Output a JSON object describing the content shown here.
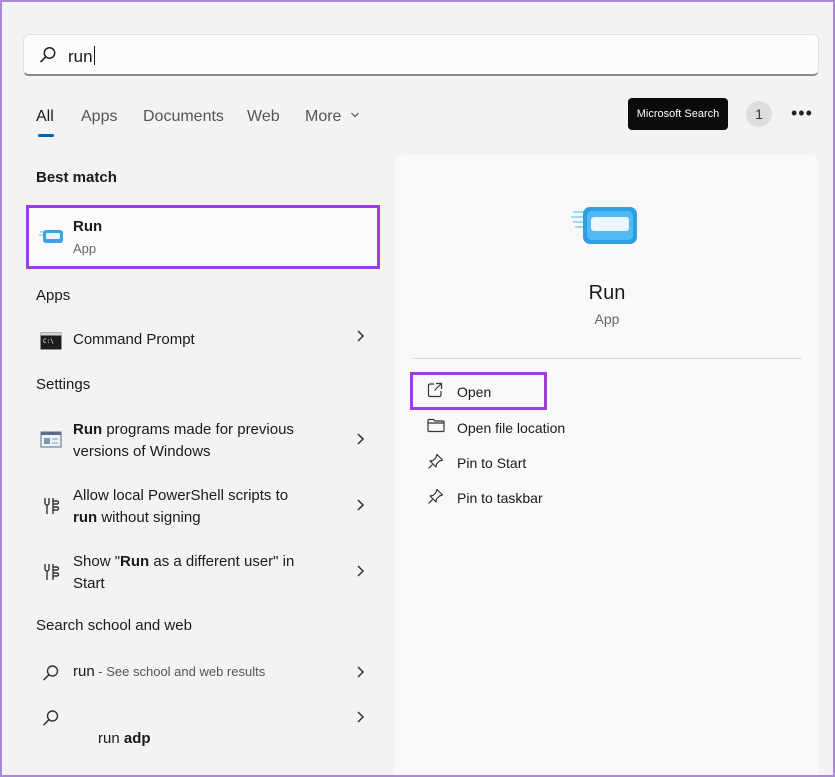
{
  "search": {
    "query": "run"
  },
  "tabs": [
    {
      "label": "All"
    },
    {
      "label": "Apps"
    },
    {
      "label": "Documents"
    },
    {
      "label": "Web"
    },
    {
      "label": "More"
    }
  ],
  "toolbar": {
    "microsoft_search": "Microsoft Search",
    "badge_count": "1",
    "more_icon": "ellipsis-icon"
  },
  "sections": {
    "best_match": "Best match",
    "apps": "Apps",
    "settings": "Settings",
    "web": "Search school and web"
  },
  "best_match": {
    "title": "Run",
    "subtitle": "App",
    "icon": "run-app-icon"
  },
  "apps": [
    {
      "label": "Command Prompt",
      "icon": "command-prompt-icon"
    }
  ],
  "settings": [
    {
      "bold": "Run",
      "rest": " programs made for previous",
      "line2": "versions of Windows",
      "icon": "compatibility-icon"
    },
    {
      "line1": "Allow local PowerShell scripts to",
      "bold": "run",
      "rest": " without signing",
      "icon": "developer-settings-icon"
    },
    {
      "pre": "Show \"",
      "bold": "Run",
      "rest": " as a different user\" in",
      "line2": "Start",
      "icon": "developer-settings-icon"
    }
  ],
  "web": [
    {
      "query": "run",
      "hint": " - See school and web results",
      "icon": "search-icon"
    },
    {
      "query": "run ",
      "bold": "adp",
      "icon": "search-icon"
    }
  ],
  "detail": {
    "title": "Run",
    "subtitle": "App",
    "actions": [
      {
        "label": "Open",
        "icon": "open-external-icon"
      },
      {
        "label": "Open file location",
        "icon": "folder-icon"
      },
      {
        "label": "Pin to Start",
        "icon": "pin-icon"
      },
      {
        "label": "Pin to taskbar",
        "icon": "pin-icon"
      }
    ]
  },
  "colors": {
    "accent": "#005fb8",
    "highlight": "#9b3fe0",
    "background": "#f3f3f3"
  }
}
